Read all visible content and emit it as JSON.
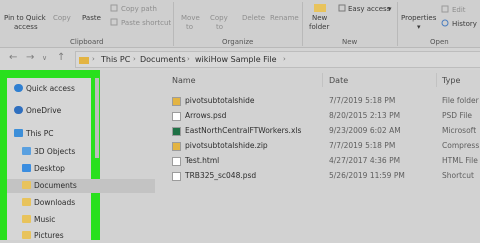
{
  "ribbon": {
    "pin_label_1": "Pin to Quick",
    "pin_label_2": "access",
    "copy_label": "Copy",
    "paste_label": "Paste",
    "copy_path_label": "Copy path",
    "paste_shortcut_label": "Paste shortcut",
    "move_to_label_1": "Move",
    "move_to_label_2": "to",
    "copy_to_label_1": "Copy",
    "copy_to_label_2": "to",
    "delete_label": "Delete",
    "rename_label": "Rename",
    "new_folder_label_1": "New",
    "new_folder_label_2": "folder",
    "easy_access_label": "Easy access",
    "properties_label": "Properties",
    "edit_label": "Edit",
    "history_label": "History",
    "groups": [
      "Clipboard",
      "Organize",
      "New",
      "Open"
    ]
  },
  "address": {
    "crumbs": [
      "This PC",
      "Documents",
      "wikiHow Sample File"
    ]
  },
  "nav_pane": {
    "items": [
      {
        "label": "Quick access",
        "icon": "star-icon",
        "color": "#2f7fd1"
      },
      {
        "label": "OneDrive",
        "icon": "cloud-icon",
        "color": "#2f6fbf"
      },
      {
        "label": "This PC",
        "icon": "computer-icon",
        "color": "#3d8fd9"
      },
      {
        "label": "3D Objects",
        "icon": "cube-icon",
        "color": "#5aa0e0"
      },
      {
        "label": "Desktop",
        "icon": "folder-icon",
        "color": "#3a8de0"
      },
      {
        "label": "Documents",
        "icon": "document-folder-icon",
        "color": "#e8c35c"
      },
      {
        "label": "Downloads",
        "icon": "download-folder-icon",
        "color": "#e8c35c"
      },
      {
        "label": "Music",
        "icon": "music-folder-icon",
        "color": "#e8c35c"
      },
      {
        "label": "Pictures",
        "icon": "pictures-folder-icon",
        "color": "#e8c35c"
      }
    ]
  },
  "columns": {
    "name": "Name",
    "date": "Date",
    "type": "Type"
  },
  "files": [
    {
      "name": "pivotsubtotalshide",
      "date": "7/7/2019 5:18 PM",
      "type": "File folder",
      "icon": "folder-icon",
      "color": "#e3b443"
    },
    {
      "name": "Arrows.psd",
      "date": "8/20/2015 2:13 PM",
      "type": "PSD File",
      "icon": "file-icon",
      "color": "#ffffff"
    },
    {
      "name": "EastNorthCentralFTWorkers.xls",
      "date": "9/23/2009 6:02 AM",
      "type": "Microsoft",
      "icon": "excel-icon",
      "color": "#1e7145"
    },
    {
      "name": "pivotsubtotalshide.zip",
      "date": "7/7/2019 5:18 PM",
      "type": "Compress",
      "icon": "zip-folder-icon",
      "color": "#e3b443"
    },
    {
      "name": "Test.html",
      "date": "4/27/2017 4:36 PM",
      "type": "HTML File",
      "icon": "html-file-icon",
      "color": "#ffffff"
    },
    {
      "name": "TRB325_sc048.psd",
      "date": "5/26/2019 11:59 PM",
      "type": "Shortcut",
      "icon": "shortcut-icon",
      "color": "#ffffff"
    }
  ],
  "colors": {
    "highlight": "#29e01d",
    "background": "#d2d2d2"
  }
}
